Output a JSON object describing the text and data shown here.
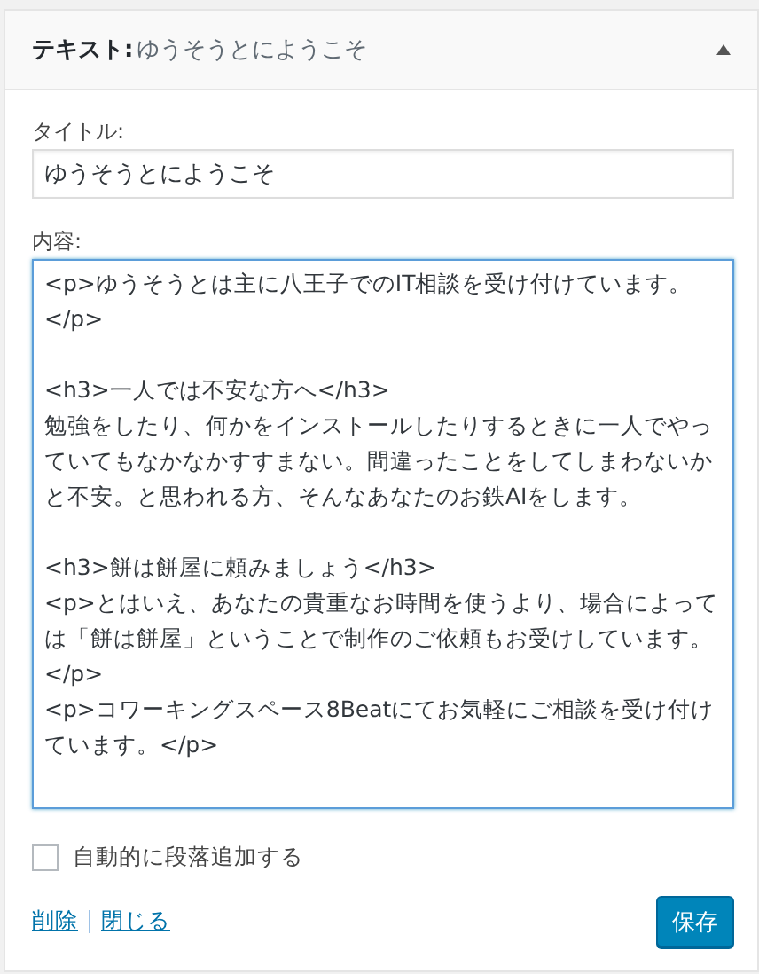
{
  "widget": {
    "type_label": "テキスト:",
    "title": "ゆうそうとにようこそ",
    "expanded": true
  },
  "title_field": {
    "label": "タイトル:",
    "value": "ゆうそうとにようこそ"
  },
  "content_field": {
    "label": "内容:",
    "value": "<p>ゆうそうとは主に八王子でのIT相談を受け付けています。\n</p>\n\n<h3>一人では不安な方へ</h3>\n勉強をしたり、何かをインストールしたりするときに一人でやっていてもなかなかすすまない。間違ったことをしてしまわないかと不安。と思われる方、そんなあなたのお鉄AIをします。\n\n<h3>餅は餅屋に頼みましょう</h3>\n<p>とはいえ、あなたの貴重なお時間を使うより、場合によっては「餅は餅屋」ということで制作のご依頼もお受けしています。</p>\n<p>コワーキングスペース8Beatにてお気軽にご相談を受け付けています。</p>"
  },
  "auto_paragraph": {
    "label": "自動的に段落追加する",
    "checked": false
  },
  "links": [
    "削除",
    "閉じる"
  ],
  "save_button": "保存"
}
